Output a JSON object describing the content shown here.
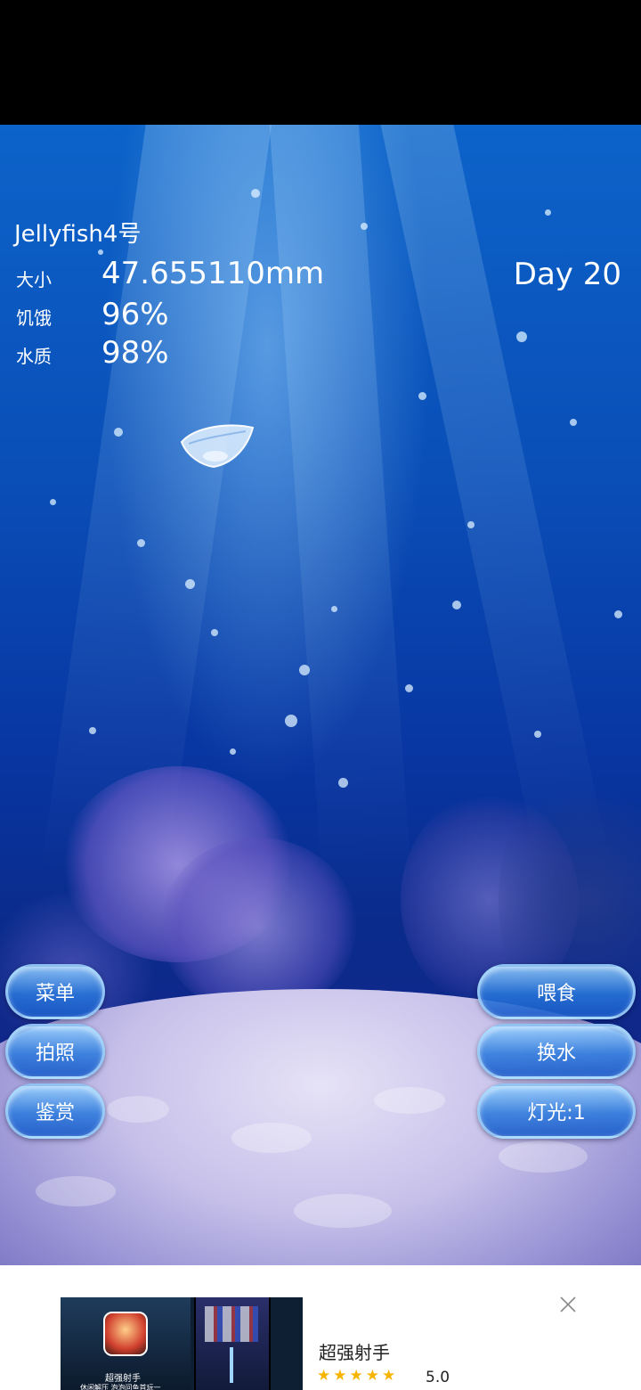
{
  "hud": {
    "name": "Jellyfish4号",
    "size_label": "大小",
    "size_value": "47.655110mm",
    "hunger_label": "饥饿",
    "hunger_value": "96%",
    "water_label": "水质",
    "water_value": "98%",
    "day": "Day 20"
  },
  "buttons": {
    "menu": "菜单",
    "photo": "拍照",
    "appreciate": "鉴赏",
    "feed": "喂食",
    "change_water": "换水",
    "light": "灯光:1"
  },
  "ad": {
    "title": "超强射手",
    "stars": "★★★★★",
    "rating": "5.0",
    "app_name": "超强射手",
    "app_tagline": "休闲解压  泡泡问鱼首玩一"
  },
  "icons": {
    "close": "close-icon",
    "jellyfish": "jellyfish-sprite",
    "star": "star-icon"
  },
  "colors": {
    "sea_top": "#0c63c9",
    "sea_deep": "#0a2b8c",
    "button_blue": "#2878dc",
    "star": "#f7b500"
  }
}
